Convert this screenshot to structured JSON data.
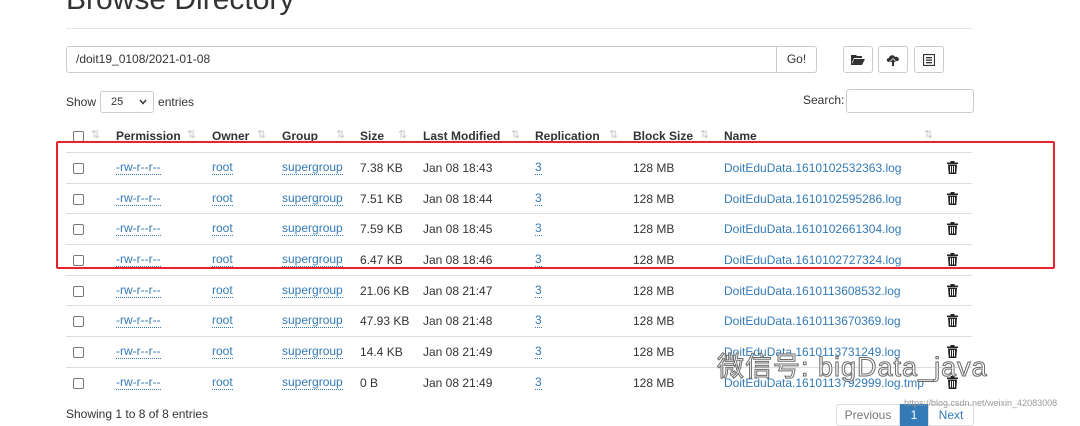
{
  "page": {
    "title": "Browse Directory"
  },
  "path_bar": {
    "value": "/doit19_0108/2021-01-08",
    "go_label": "Go!"
  },
  "toolbar": {
    "icons": [
      "folder-open-icon",
      "upload-icon",
      "list-icon"
    ]
  },
  "show_entries": {
    "show_label": "Show",
    "selected": "25",
    "entries_label": "entries"
  },
  "search": {
    "label": "Search:"
  },
  "table": {
    "columns": [
      "Permission",
      "Owner",
      "Group",
      "Size",
      "Last Modified",
      "Replication",
      "Block Size",
      "Name"
    ],
    "rows": [
      {
        "permission": "-rw-r--r--",
        "owner": "root",
        "group": "supergroup",
        "size": "7.38 KB",
        "modified": "Jan 08 18:43",
        "replication": "3",
        "block_size": "128 MB",
        "name": "DoitEduData.1610102532363.log"
      },
      {
        "permission": "-rw-r--r--",
        "owner": "root",
        "group": "supergroup",
        "size": "7.51 KB",
        "modified": "Jan 08 18:44",
        "replication": "3",
        "block_size": "128 MB",
        "name": "DoitEduData.1610102595286.log"
      },
      {
        "permission": "-rw-r--r--",
        "owner": "root",
        "group": "supergroup",
        "size": "7.59 KB",
        "modified": "Jan 08 18:45",
        "replication": "3",
        "block_size": "128 MB",
        "name": "DoitEduData.1610102661304.log"
      },
      {
        "permission": "-rw-r--r--",
        "owner": "root",
        "group": "supergroup",
        "size": "6.47 KB",
        "modified": "Jan 08 18:46",
        "replication": "3",
        "block_size": "128 MB",
        "name": "DoitEduData.1610102727324.log"
      },
      {
        "permission": "-rw-r--r--",
        "owner": "root",
        "group": "supergroup",
        "size": "21.06 KB",
        "modified": "Jan 08 21:47",
        "replication": "3",
        "block_size": "128 MB",
        "name": "DoitEduData.1610113608532.log"
      },
      {
        "permission": "-rw-r--r--",
        "owner": "root",
        "group": "supergroup",
        "size": "47.93 KB",
        "modified": "Jan 08 21:48",
        "replication": "3",
        "block_size": "128 MB",
        "name": "DoitEduData.1610113670369.log"
      },
      {
        "permission": "-rw-r--r--",
        "owner": "root",
        "group": "supergroup",
        "size": "14.4 KB",
        "modified": "Jan 08 21:49",
        "replication": "3",
        "block_size": "128 MB",
        "name": "DoitEduData.1610113731249.log"
      },
      {
        "permission": "-rw-r--r--",
        "owner": "root",
        "group": "supergroup",
        "size": "0 B",
        "modified": "Jan 08 21:49",
        "replication": "3",
        "block_size": "128 MB",
        "name": "DoitEduData.1610113792999.log.tmp"
      }
    ]
  },
  "footer": {
    "info": "Showing 1 to 8 of 8 entries",
    "previous": "Previous",
    "current_page": "1",
    "next": "Next"
  },
  "watermark": {
    "text": "微信号: bigData_java",
    "url_text": "https://blog.csdn.net/weixin_42083008"
  },
  "colors": {
    "link": "#337ab7",
    "highlight_border": "#e8232f",
    "row_border": "#dddddd"
  }
}
